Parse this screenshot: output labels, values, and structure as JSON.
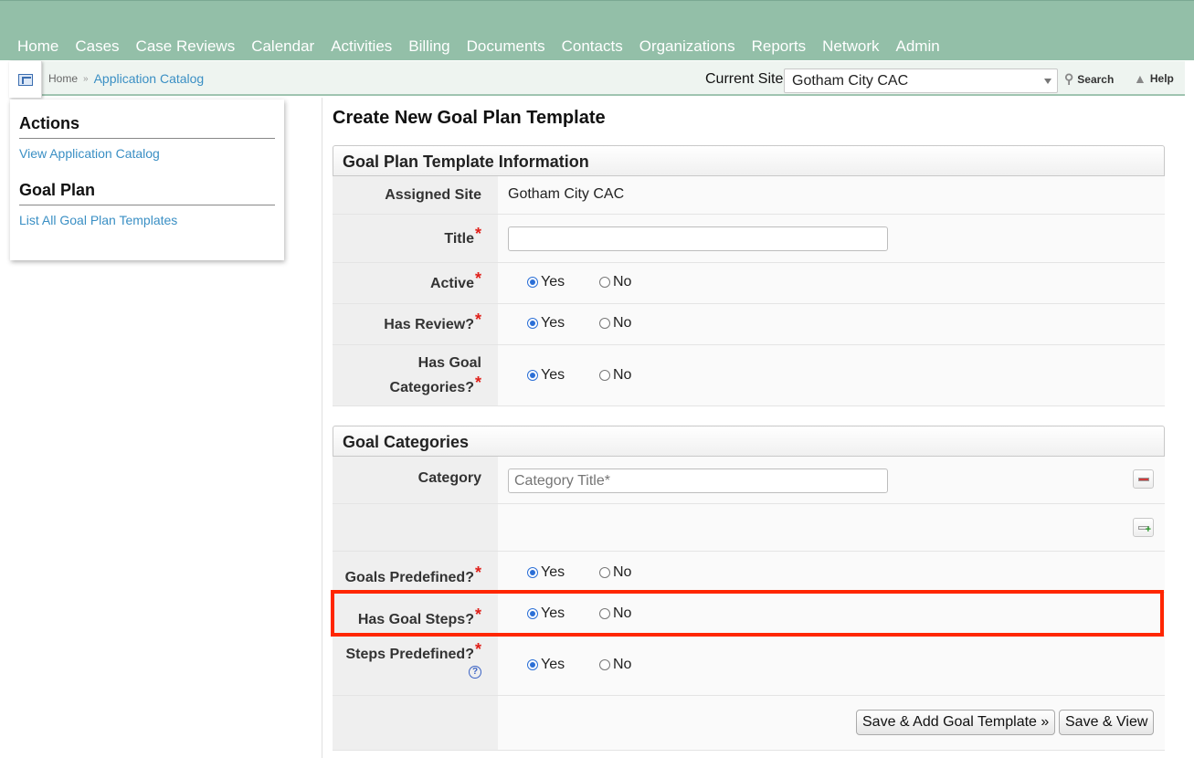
{
  "nav": {
    "items": [
      "Home",
      "Cases",
      "Case Reviews",
      "Calendar",
      "Activities",
      "Billing",
      "Documents",
      "Contacts",
      "Organizations",
      "Reports",
      "Network",
      "Admin"
    ]
  },
  "breadcrumb": {
    "home": "Home",
    "separator": "»",
    "current": "Application Catalog"
  },
  "site": {
    "label": "Current Site",
    "selected": "Gotham City CAC"
  },
  "toolbar": {
    "search": "Search",
    "help": "Help"
  },
  "sidebar": {
    "actions_heading": "Actions",
    "actions_link": "View Application Catalog",
    "goal_heading": "Goal Plan",
    "goal_link": "List All Goal Plan Templates"
  },
  "page": {
    "title": "Create New Goal Plan Template"
  },
  "info_panel": {
    "heading": "Goal Plan Template Information",
    "assigned_site_label": "Assigned Site",
    "assigned_site_value": "Gotham City CAC",
    "title_label": "Title",
    "title_value": "",
    "active_label": "Active",
    "has_review_label": "Has Review?",
    "has_goal_categories_label_1": "Has Goal",
    "has_goal_categories_label_2": "Categories?"
  },
  "required_mark": "*",
  "options": {
    "yes": "Yes",
    "no": "No"
  },
  "categories_panel": {
    "heading": "Goal Categories",
    "category_label": "Category",
    "category_placeholder": "Category Title*",
    "goals_predefined_label": "Goals Predefined?",
    "has_goal_steps_label": "Has Goal Steps?",
    "steps_predefined_label": "Steps Predefined?",
    "help_symbol": "?"
  },
  "buttons": {
    "save_add": "Save & Add Goal Template »",
    "save_view": "Save & View"
  },
  "colors": {
    "nav_bg": "#93bfa8",
    "link": "#3a8fc4",
    "required": "#e0201a",
    "highlight": "#ff2600"
  }
}
